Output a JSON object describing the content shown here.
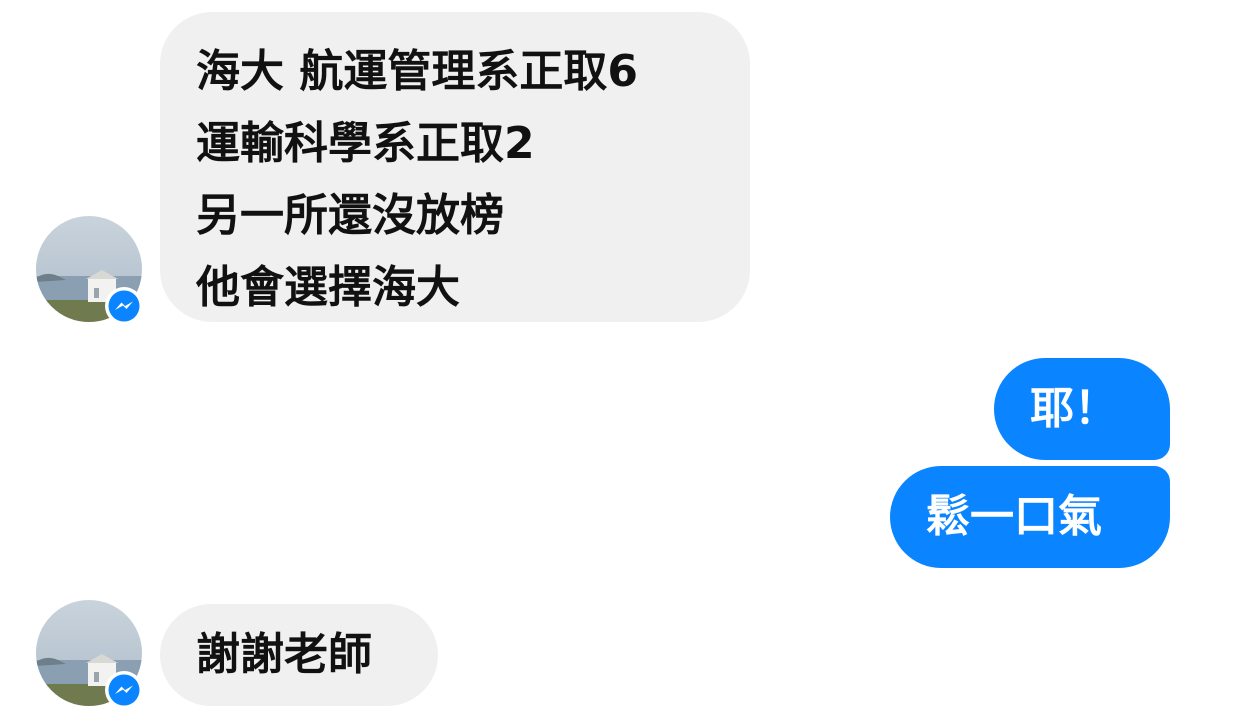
{
  "colors": {
    "incoming_bubble": "#f0f0f0",
    "outgoing_bubble": "#0a84ff",
    "incoming_text": "#111111",
    "outgoing_text": "#ffffff",
    "messenger_badge": "#0a84ff"
  },
  "messages": [
    {
      "direction": "incoming",
      "lines": [
        "海大 航運管理系正取6",
        "運輸科學系正取2",
        "另一所還沒放榜",
        "他會選擇海大"
      ]
    },
    {
      "direction": "outgoing",
      "text": "耶！"
    },
    {
      "direction": "outgoing",
      "text": "鬆一口氣"
    },
    {
      "direction": "incoming",
      "text": "謝謝老師"
    }
  ],
  "icons": {
    "avatar": "contact-avatar-photo",
    "badge": "messenger-icon"
  }
}
